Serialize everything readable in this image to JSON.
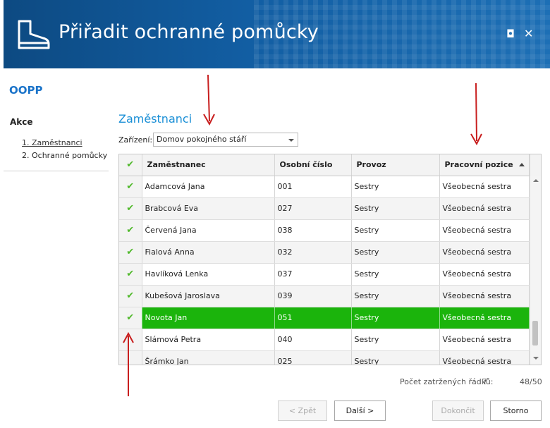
{
  "window": {
    "title": "Přiřadit ochranné pomůcky",
    "icon": "boot-icon",
    "maximize_glyph": "◘",
    "close_glyph": "✕"
  },
  "sidebar": {
    "app_title": "OOPP",
    "section_label": "Akce",
    "steps": [
      {
        "label": "1. Zaměstnanci"
      },
      {
        "label": "2. Ochranné pomůcky"
      }
    ]
  },
  "main": {
    "section_title": "Zaměstnanci",
    "device": {
      "label": "Zařízení:",
      "value": "Domov pokojného stáří"
    },
    "grid": {
      "columns": [
        "Zaměstnanec",
        "Osobní číslo",
        "Provoz",
        "Pracovní pozice"
      ],
      "check_glyph": "✔",
      "rows": [
        {
          "name": "Adamcová Jana",
          "id": "001",
          "provoz": "Sestry",
          "pozice": "Všeobecná sestra",
          "checked": true
        },
        {
          "name": "Brabcová Eva",
          "id": "027",
          "provoz": "Sestry",
          "pozice": "Všeobecná sestra",
          "checked": true
        },
        {
          "name": "Červená Jana",
          "id": "038",
          "provoz": "Sestry",
          "pozice": "Všeobecná sestra",
          "checked": true
        },
        {
          "name": "Fialová Anna",
          "id": "032",
          "provoz": "Sestry",
          "pozice": "Všeobecná sestra",
          "checked": true
        },
        {
          "name": "Havlíková Lenka",
          "id": "037",
          "provoz": "Sestry",
          "pozice": "Všeobecná sestra",
          "checked": true
        },
        {
          "name": "Kubešová Jaroslava",
          "id": "039",
          "provoz": "Sestry",
          "pozice": "Všeobecná sestra",
          "checked": true
        },
        {
          "name": "Novota Jan",
          "id": "051",
          "provoz": "Sestry",
          "pozice": "Všeobecná sestra",
          "checked": true,
          "selected": true
        },
        {
          "name": "Slámová Petra",
          "id": "040",
          "provoz": "Sestry",
          "pozice": "Všeobecná sestra",
          "checked": false
        },
        {
          "name": "Šrámko Jan",
          "id": "025",
          "provoz": "Sestry",
          "pozice": "Všeobecná sestra",
          "checked": false
        }
      ]
    },
    "footer": {
      "checked_rows_label": "Počet zatržených řádků:",
      "checked_rows_count": "7",
      "row_ratio": "48/50"
    }
  },
  "buttons": {
    "back": "< Zpět",
    "next": "Další >",
    "finish": "Dokončit",
    "cancel": "Storno"
  },
  "colors": {
    "header": "#125ea3",
    "accent": "#1a8fd6",
    "selected_row": "#1bb40c",
    "check": "#4fb82a",
    "annotation": "#c81e1e"
  }
}
